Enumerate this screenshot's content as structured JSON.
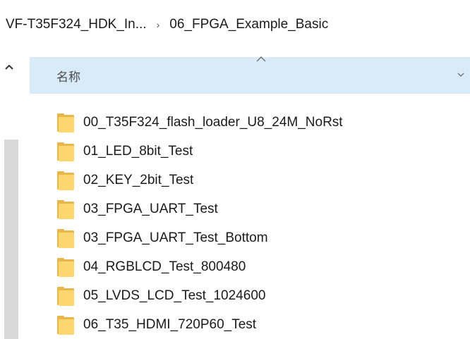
{
  "breadcrumb": {
    "items": [
      "VF-T35F324_HDK_In...",
      "06_FPGA_Example_Basic"
    ],
    "separator": "›"
  },
  "column_header": {
    "name_label": "名称",
    "sort": "ascending",
    "dropdown_icon": "chevron-down-icon"
  },
  "files": [
    {
      "name": "00_T35F324_flash_loader_U8_24M_NoRst",
      "type": "folder"
    },
    {
      "name": "01_LED_8bit_Test",
      "type": "folder"
    },
    {
      "name": "02_KEY_2bit_Test",
      "type": "folder"
    },
    {
      "name": "03_FPGA_UART_Test",
      "type": "folder"
    },
    {
      "name": "03_FPGA_UART_Test_Bottom",
      "type": "folder"
    },
    {
      "name": "04_RGBLCD_Test_800480",
      "type": "folder"
    },
    {
      "name": "05_LVDS_LCD_Test_1024600",
      "type": "folder"
    },
    {
      "name": "06_T35_HDMI_720P60_Test",
      "type": "folder"
    }
  ],
  "colors": {
    "header_bg": "#d9ebf9",
    "scroll_track": "#d9d9d9",
    "folder_body": "#fcd770",
    "folder_back": "#e8b64a"
  }
}
